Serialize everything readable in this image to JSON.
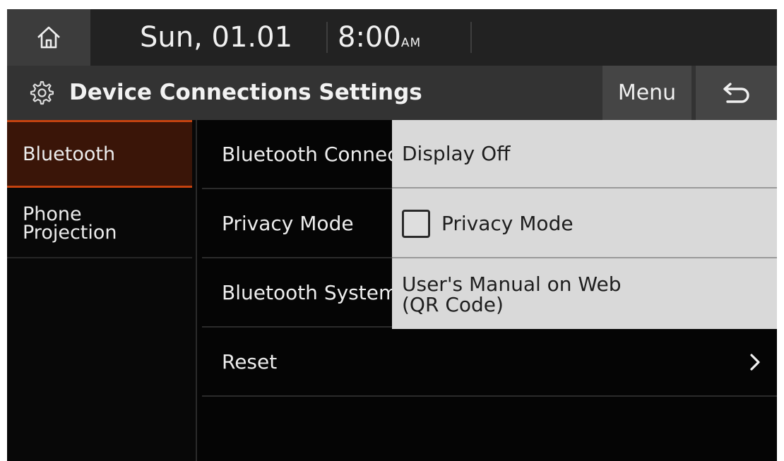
{
  "statusbar": {
    "home_icon": "home-icon",
    "date": "Sun, 01.01",
    "time": "8:00",
    "ampm": "AM"
  },
  "titlebar": {
    "icon": "gear-icon",
    "title": "Device Connections Settings",
    "menu_label": "Menu",
    "back_icon": "back-arrow-icon"
  },
  "sidebar": {
    "items": [
      {
        "label": "Bluetooth",
        "active": true
      },
      {
        "label_line1": "Phone",
        "label_line2": "Projection",
        "active": false
      }
    ]
  },
  "list": {
    "rows": [
      {
        "label": "Bluetooth Connections"
      },
      {
        "label": "Privacy Mode"
      },
      {
        "label": "Bluetooth System Info"
      },
      {
        "label": "Reset",
        "icon": "chevron-right-icon"
      }
    ]
  },
  "popup": {
    "items": [
      {
        "label": "Display Off"
      },
      {
        "label": "Privacy Mode",
        "checked": false
      },
      {
        "line1": "User's Manual on Web",
        "line2": "(QR Code)"
      }
    ]
  },
  "colors": {
    "accent": "#c4420f",
    "active_bg": "#3a1508",
    "popup_bg": "#d9d9d9"
  }
}
